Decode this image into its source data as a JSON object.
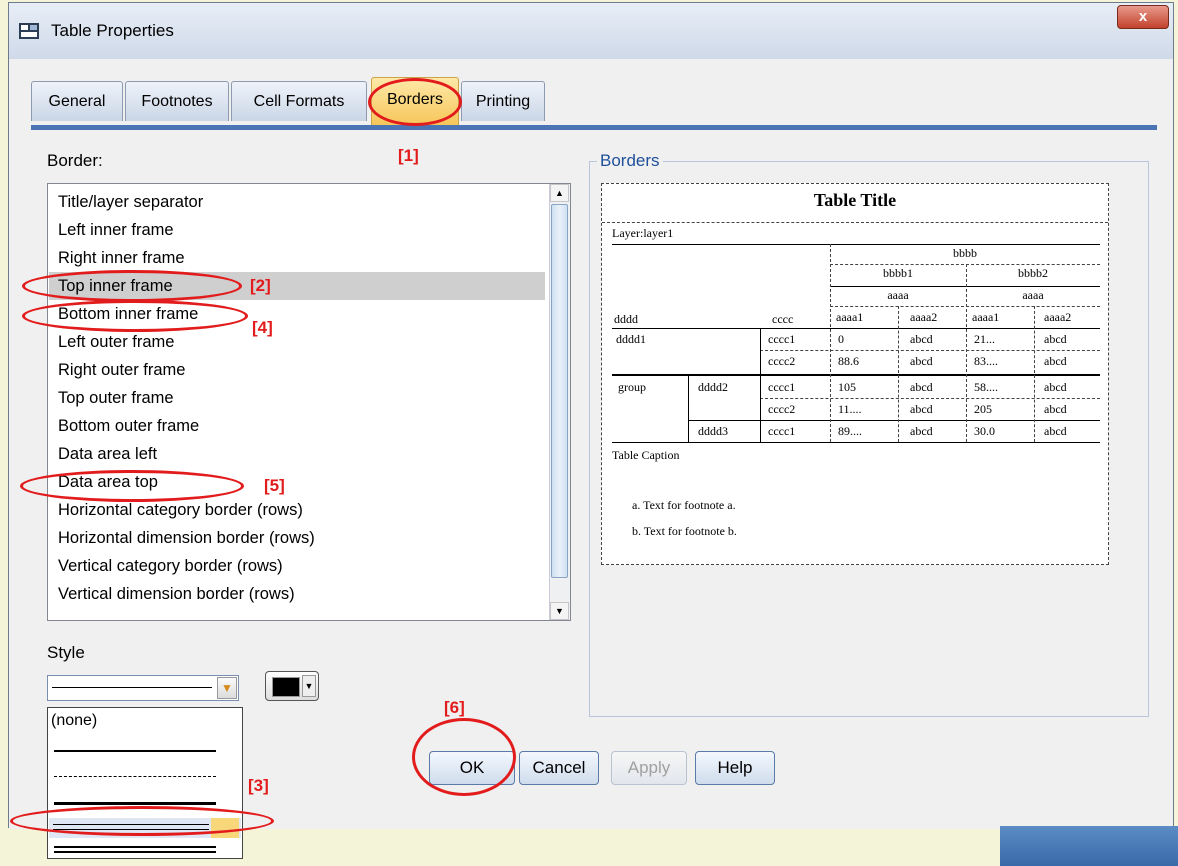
{
  "window": {
    "title": "Table Properties",
    "close_label": "x"
  },
  "tabs": [
    "General",
    "Footnotes",
    "Cell Formats",
    "Borders",
    "Printing"
  ],
  "active_tab": "Borders",
  "border_section": {
    "label": "Border:",
    "items": [
      "Title/layer separator",
      "Left inner frame",
      "Right inner frame",
      "Top inner frame",
      "Bottom inner frame",
      "Left outer frame",
      "Right outer frame",
      "Top outer frame",
      "Bottom outer frame",
      "Data area left",
      "Data area top",
      "Horizontal category border (rows)",
      "Horizontal dimension border (rows)",
      "Vertical category border (rows)",
      "Vertical dimension border (rows)"
    ],
    "selected": "Top inner frame"
  },
  "style_section": {
    "label": "Style",
    "dropdown_options": [
      "(none)",
      "solid",
      "dashed",
      "thick",
      "double-thin",
      "double"
    ],
    "highlighted_option": "double-thin",
    "color": "#000000"
  },
  "borders_group": {
    "title": "Borders",
    "preview": {
      "table_title": "Table Title",
      "layer": "Layer:layer1",
      "col_dim": "bbbb",
      "col_groups": [
        "bbbb1",
        "bbbb2"
      ],
      "col_sub": [
        "aaaa",
        "aaaa"
      ],
      "row_headers": [
        "dddd",
        "cccc"
      ],
      "col_leaves": [
        "aaaa1",
        "aaaa2",
        "aaaa1",
        "aaaa2"
      ],
      "rows": [
        {
          "g": "",
          "d": "dddd1",
          "c": "cccc1",
          "v": [
            "0",
            "abcd",
            "21...",
            "abcd"
          ]
        },
        {
          "g": "",
          "d": "",
          "c": "cccc2",
          "v": [
            "88.6",
            "abcd",
            "83....",
            "abcd"
          ]
        },
        {
          "g": "group",
          "d": "dddd2",
          "c": "cccc1",
          "v": [
            "105",
            "abcd",
            "58....",
            "abcd"
          ]
        },
        {
          "g": "",
          "d": "",
          "c": "cccc2",
          "v": [
            "11....",
            "abcd",
            "205",
            "abcd"
          ]
        },
        {
          "g": "",
          "d": "dddd3",
          "c": "cccc1",
          "v": [
            "89....",
            "abcd",
            "30.0",
            "abcd"
          ]
        }
      ],
      "caption": "Table Caption",
      "footnotes": [
        "a. Text for footnote a.",
        "b. Text for footnote b."
      ]
    }
  },
  "buttons": {
    "ok": "OK",
    "cancel": "Cancel",
    "apply": "Apply",
    "help": "Help"
  },
  "annotations": [
    "[1]",
    "[2]",
    "[3]",
    "[4]",
    "[5]",
    "[6]"
  ],
  "annotation_color": "#e21c1c"
}
